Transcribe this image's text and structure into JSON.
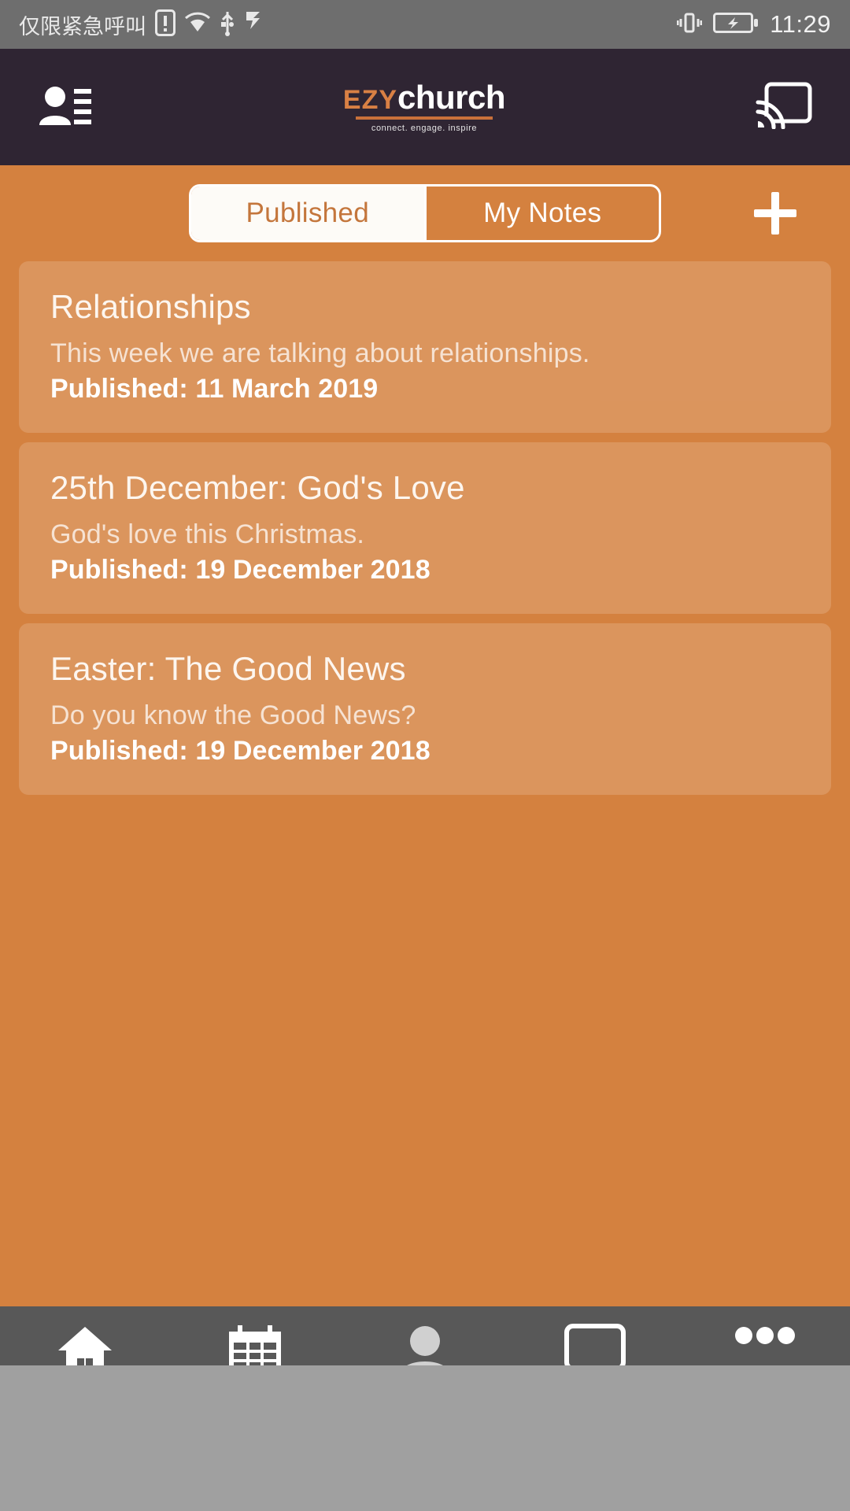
{
  "statusbar": {
    "carrier_text": "仅限紧急呼叫",
    "time": "11:29",
    "icons": [
      "sim-alert-icon",
      "wifi-icon",
      "usb-icon",
      "flag-icon",
      "vibrate-icon",
      "battery-charging-icon"
    ]
  },
  "appbar": {
    "menu_icon": "contacts-icon",
    "cast_icon": "cast-icon",
    "logo": {
      "prefix": "EZY",
      "suffix": "church",
      "tagline": "connect. engage. inspire"
    }
  },
  "tabs": {
    "items": [
      {
        "label": "Published",
        "active": true
      },
      {
        "label": "My Notes",
        "active": false
      }
    ],
    "add_icon": "plus-icon"
  },
  "cards": [
    {
      "title": "Relationships",
      "description": "This week we are talking about relationships.",
      "meta": "Published: 11 March 2019"
    },
    {
      "title": "25th December: God's Love",
      "description": "God's love this Christmas.",
      "meta": "Published: 19 December 2018"
    },
    {
      "title": "Easter: The Good News",
      "description": "Do you know the Good News?",
      "meta": "Published: 19 December 2018"
    }
  ],
  "bottomnav": {
    "items": [
      {
        "icon": "home-icon",
        "name": "nav-home"
      },
      {
        "icon": "calendar-icon",
        "name": "nav-calendar"
      },
      {
        "icon": "person-icon",
        "name": "nav-profile"
      },
      {
        "icon": "card-icon",
        "name": "nav-card"
      },
      {
        "icon": "more-icon",
        "name": "nav-more"
      }
    ]
  },
  "colors": {
    "accent_orange": "#d4813f",
    "header_dark": "#2f2533",
    "logo_orange": "#d98044",
    "card_overlay": "rgba(255,255,255,0.16)",
    "statusbar_gray": "#6e6e6e",
    "bottomnav_gray": "#585858"
  }
}
